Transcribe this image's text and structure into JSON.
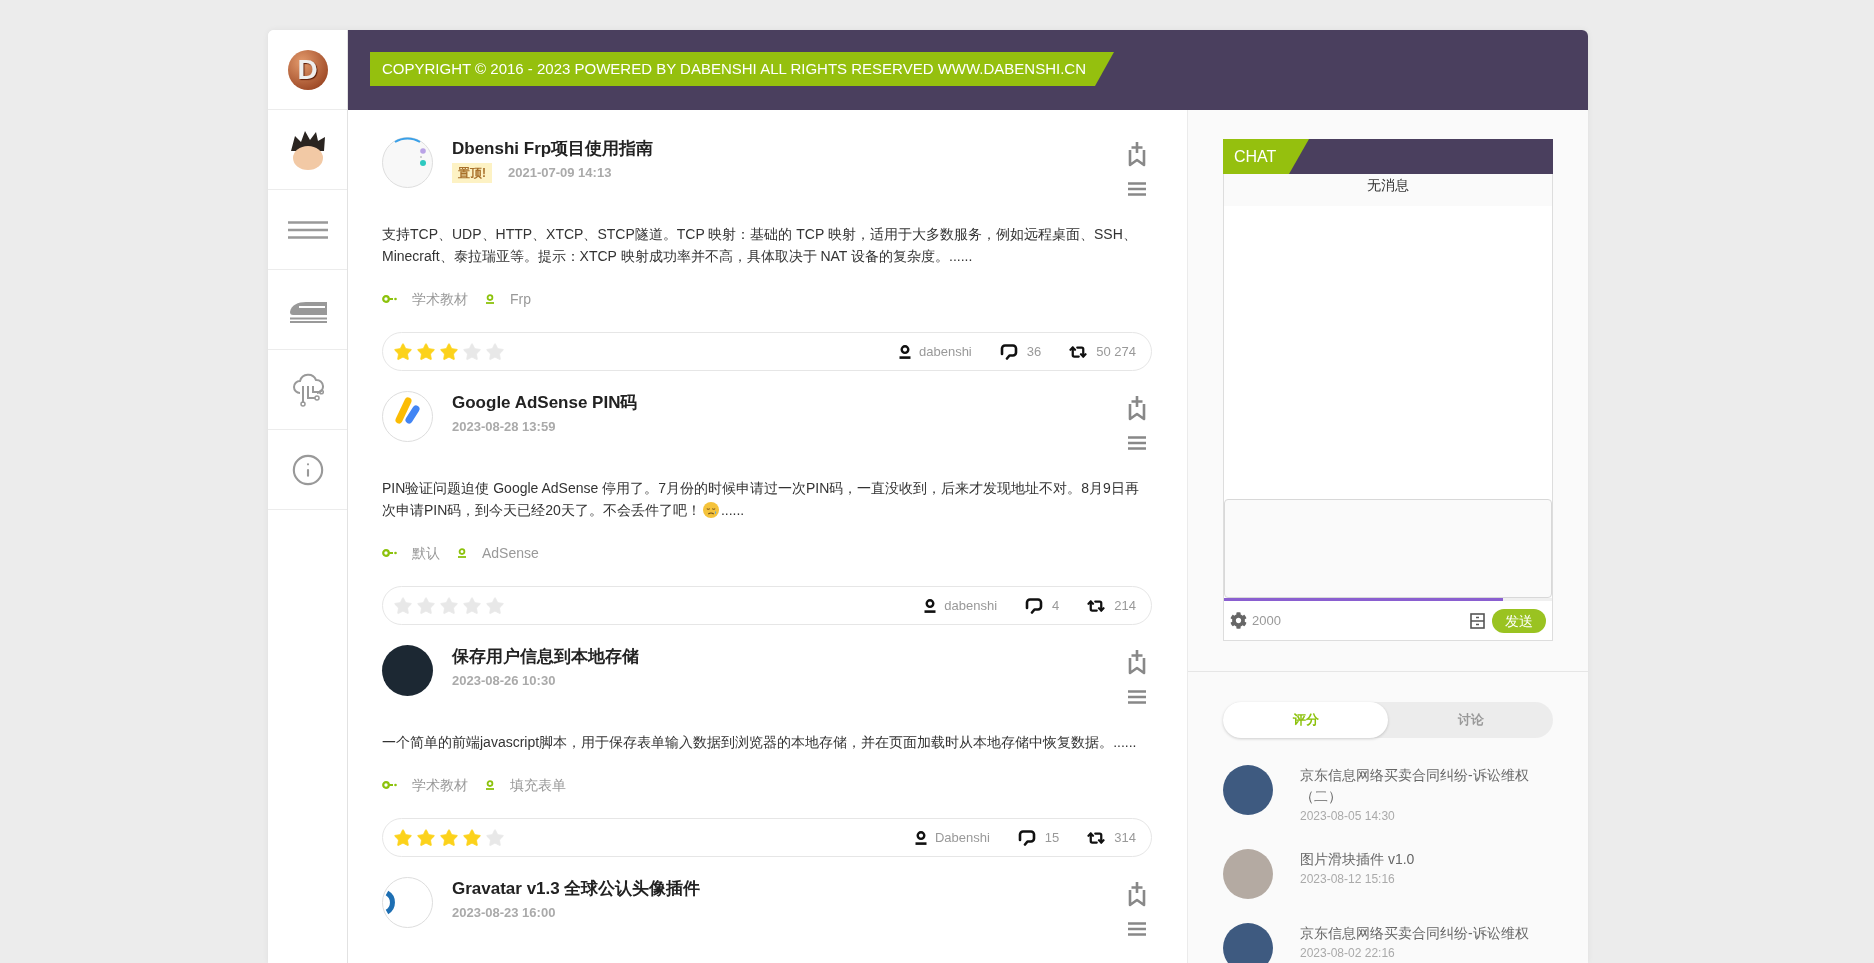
{
  "sidebar": {
    "logo_letter": "D"
  },
  "header": {
    "banner": "COPYRIGHT © 2016 - 2023 POWERED BY DABENSHI ALL RIGHTS RESERVED WWW.DABENSHI.CN"
  },
  "posts": [
    {
      "thumb": {
        "kind": "dots"
      },
      "title": "Dbenshi Frp项目使用指南",
      "badge": "置顶!",
      "date": "2021-07-09 14:13",
      "excerpt": [
        {
          "kind": "text",
          "text": "支持TCP、UDP、HTTP、XTCP、STCP隧道。TCP 映射：基础的 TCP 映射，适用于大多数服务，例如远程桌面、SSH、Minecraft、泰拉瑞亚等。提示：XTCP 映射成功率并不高，具体取决于 NAT 设备的复杂度。......"
        }
      ],
      "category": "学术教材",
      "tag": "Frp",
      "stars": 3,
      "author": "dabenshi",
      "comments": "36",
      "views": "50 274"
    },
    {
      "thumb": {
        "kind": "stripes"
      },
      "title": "Google AdSense PIN码",
      "date": "2023-08-28 13:59",
      "excerpt": [
        {
          "kind": "text",
          "text": "PIN验证问题迫使 Google AdSense 停用了。7月份的时候申请过一次PIN码，一直没收到，后来才发现地址不对。8月9日再次申请PIN码，到今天已经20天了。不会丢件了吧！"
        },
        {
          "kind": "emoji"
        },
        {
          "kind": "text",
          "text": "......"
        }
      ],
      "category": "默认",
      "tag": "AdSense",
      "stars": 0,
      "author": "dabenshi",
      "comments": "4",
      "views": "214"
    },
    {
      "thumb": {
        "kind": "photo"
      },
      "title": "保存用户信息到本地存储",
      "date": "2023-08-26 10:30",
      "excerpt": [
        {
          "kind": "text",
          "text": "一个简单的前端javascript脚本，用于保存表单输入数据到浏览器的本地存储，并在页面加载时从本地存储中恢复数据。......"
        }
      ],
      "category": "学术教材",
      "tag": "填充表单",
      "stars": 4,
      "author": "Dabenshi",
      "comments": "15",
      "views": "314"
    },
    {
      "thumb": {
        "kind": "ring"
      },
      "title": "Gravatar v1.3 全球公认头像插件",
      "date": "2023-08-23 16:00"
    }
  ],
  "chat": {
    "title": "CHAT",
    "status": "无消息",
    "progress": {
      "level": 0.85
    },
    "counter": "2000",
    "send": "发送"
  },
  "tabs": [
    {
      "label": "评分",
      "selected": true
    },
    {
      "label": "讨论",
      "selected": false
    }
  ],
  "list": [
    {
      "thumb": {
        "kind": "dark"
      },
      "title": "京东信息网络买卖合同纠纷-诉讼维权（二）",
      "date": "2023-08-05 14:30"
    },
    {
      "thumb": {
        "kind": "light"
      },
      "title": "图片滑块插件 v1.0",
      "date": "2023-08-12 15:16"
    },
    {
      "thumb": {
        "kind": "dark"
      },
      "title": "京东信息网络买卖合同纠纷-诉讼维权",
      "date": "2023-08-02 22:16"
    }
  ]
}
